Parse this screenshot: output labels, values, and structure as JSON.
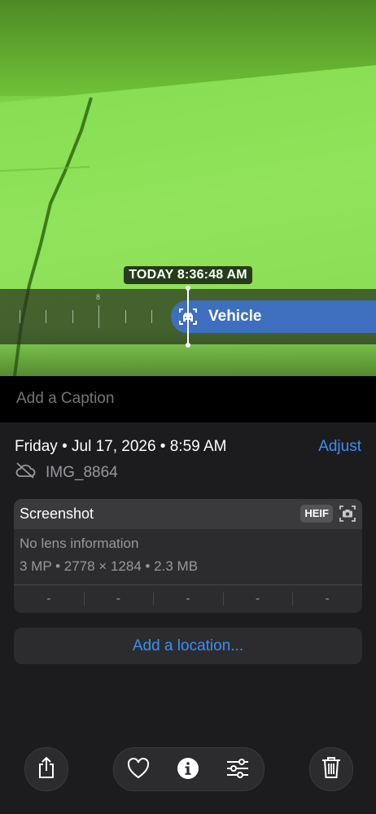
{
  "photo": {
    "timestamp": "TODAY 8:36:48 AM",
    "timeline_tick_label": "8",
    "detection_label": "Vehicle",
    "detection_icon": "car-icon"
  },
  "caption": {
    "placeholder": "Add a Caption"
  },
  "info": {
    "date": "Friday • Jul 17, 2026 • 8:59 AM",
    "adjust_label": "Adjust",
    "filename": "IMG_8864"
  },
  "metadata": {
    "title": "Screenshot",
    "format_badge": "HEIF",
    "lens": "No lens information",
    "specs": "3 MP • 2778 × 1284 • 2.3 MB",
    "exif": [
      "-",
      "-",
      "-",
      "-",
      "-"
    ]
  },
  "location": {
    "label": "Add a location..."
  },
  "colors": {
    "accent": "#3a8ff6",
    "detection_chip": "#3d6fbe",
    "background": "#1c1c1e"
  },
  "toolbar": {
    "icons": [
      "share-icon",
      "heart-icon",
      "info-icon",
      "adjust-sliders-icon",
      "trash-icon"
    ]
  }
}
